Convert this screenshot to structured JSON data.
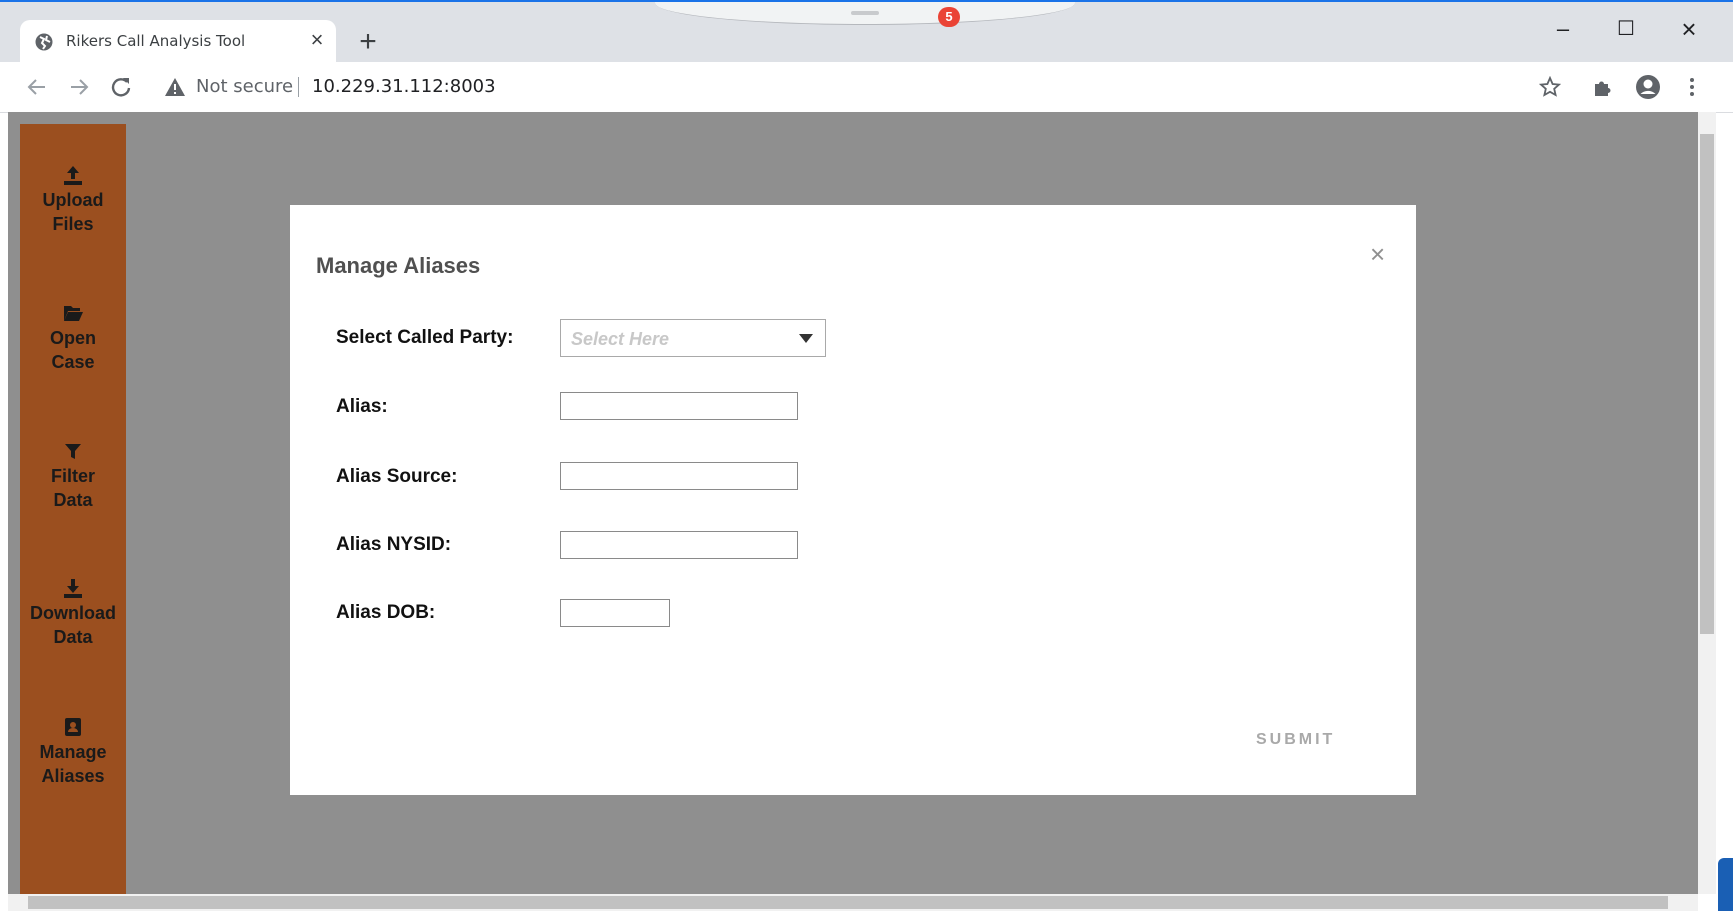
{
  "browser": {
    "tab_title": "Rikers Call Analysis Tool",
    "tab_close": "×",
    "new_tab": "+",
    "notification_count": "5",
    "security_label": "Not secure",
    "url": "10.229.31.112:8003",
    "window_controls": {
      "minimize": "–",
      "maximize": "☐",
      "close": "×"
    }
  },
  "sidebar": {
    "items": [
      {
        "label": "Upload\nFiles",
        "icon": "upload-icon"
      },
      {
        "label": "Open\nCase",
        "icon": "folder-open-icon"
      },
      {
        "label": "Filter\nData",
        "icon": "filter-icon"
      },
      {
        "label": "Download\nData",
        "icon": "download-icon"
      },
      {
        "label": "Manage\nAliases",
        "icon": "address-book-icon"
      }
    ],
    "color": "#9b4f1f"
  },
  "modal": {
    "title": "Manage Aliases",
    "close": "×",
    "fields": {
      "called_party": {
        "label": "Select Called Party:",
        "placeholder": "Select Here",
        "value": ""
      },
      "alias": {
        "label": "Alias:",
        "value": ""
      },
      "alias_source": {
        "label": "Alias Source:",
        "value": ""
      },
      "alias_nysid": {
        "label": "Alias NYSID:",
        "value": ""
      },
      "alias_dob": {
        "label": "Alias DOB:",
        "value": ""
      }
    },
    "submit_label": "SUBMIT"
  }
}
